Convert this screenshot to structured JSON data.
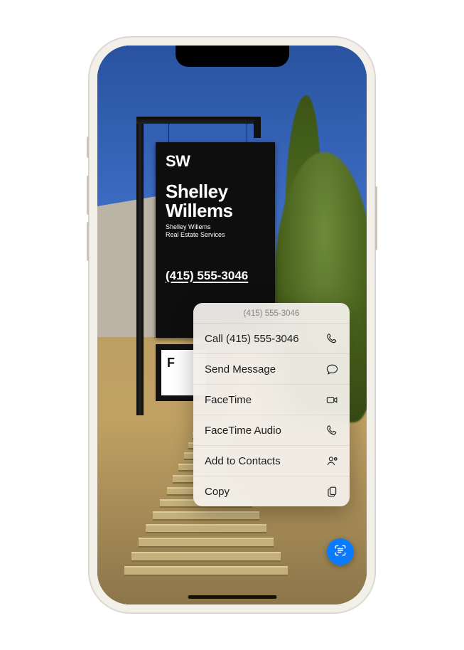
{
  "sign": {
    "logo": "SW",
    "name_line1": "Shelley",
    "name_line2": "Willems",
    "sub_line1": "Shelley Willems",
    "sub_line2": "Real Estate Services",
    "phone": "(415) 555-3046",
    "secondary_prefix": "F"
  },
  "menu": {
    "header": "(415) 555-3046",
    "items": [
      {
        "label": "Call (415) 555-3046",
        "icon": "phone-icon"
      },
      {
        "label": "Send Message",
        "icon": "message-icon"
      },
      {
        "label": "FaceTime",
        "icon": "video-icon"
      },
      {
        "label": "FaceTime Audio",
        "icon": "phone-icon"
      },
      {
        "label": "Add to Contacts",
        "icon": "add-contact-icon"
      },
      {
        "label": "Copy",
        "icon": "copy-icon"
      }
    ]
  },
  "colors": {
    "accent": "#0a7aff",
    "menu_bg": "rgba(244,242,238,.93)"
  }
}
